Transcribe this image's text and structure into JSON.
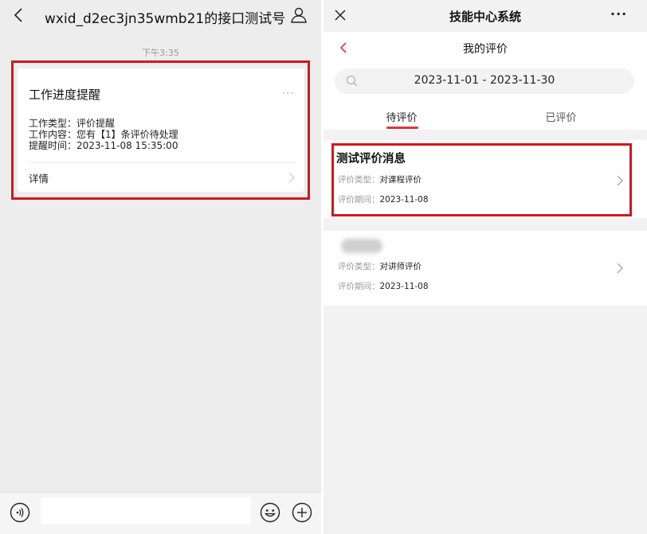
{
  "left": {
    "header": {
      "title": "wxid_d2ec3jn35wmb21的接口测试号"
    },
    "timestamp": "下午3:35",
    "card": {
      "title": "工作进度提醒",
      "more": "···",
      "lines": [
        "工作类型：评价提醒",
        "工作内容：您有【1】条评价待处理",
        "提醒时间：2023-11-08 15:35:00"
      ],
      "detail_label": "详情"
    }
  },
  "right": {
    "header": {
      "title": "技能中心系统",
      "more": "···"
    },
    "page_title": "我的评价",
    "date_range": "2023-11-01 - 2023-11-30",
    "tabs": [
      {
        "label": "待评价",
        "active": true
      },
      {
        "label": "已评价",
        "active": false
      }
    ],
    "items": [
      {
        "title": "测试评价消息",
        "type_label": "评价类型：",
        "type_value": "对课程评价",
        "period_label": "评价期间：",
        "period_value": "2023-11-08"
      },
      {
        "title": "",
        "type_label": "评价类型：",
        "type_value": "对讲师评价",
        "period_label": "评价期间：",
        "period_value": "2023-11-08"
      }
    ]
  },
  "colors": {
    "accent": "#e0333c",
    "highlight_box": "#d3161c"
  }
}
